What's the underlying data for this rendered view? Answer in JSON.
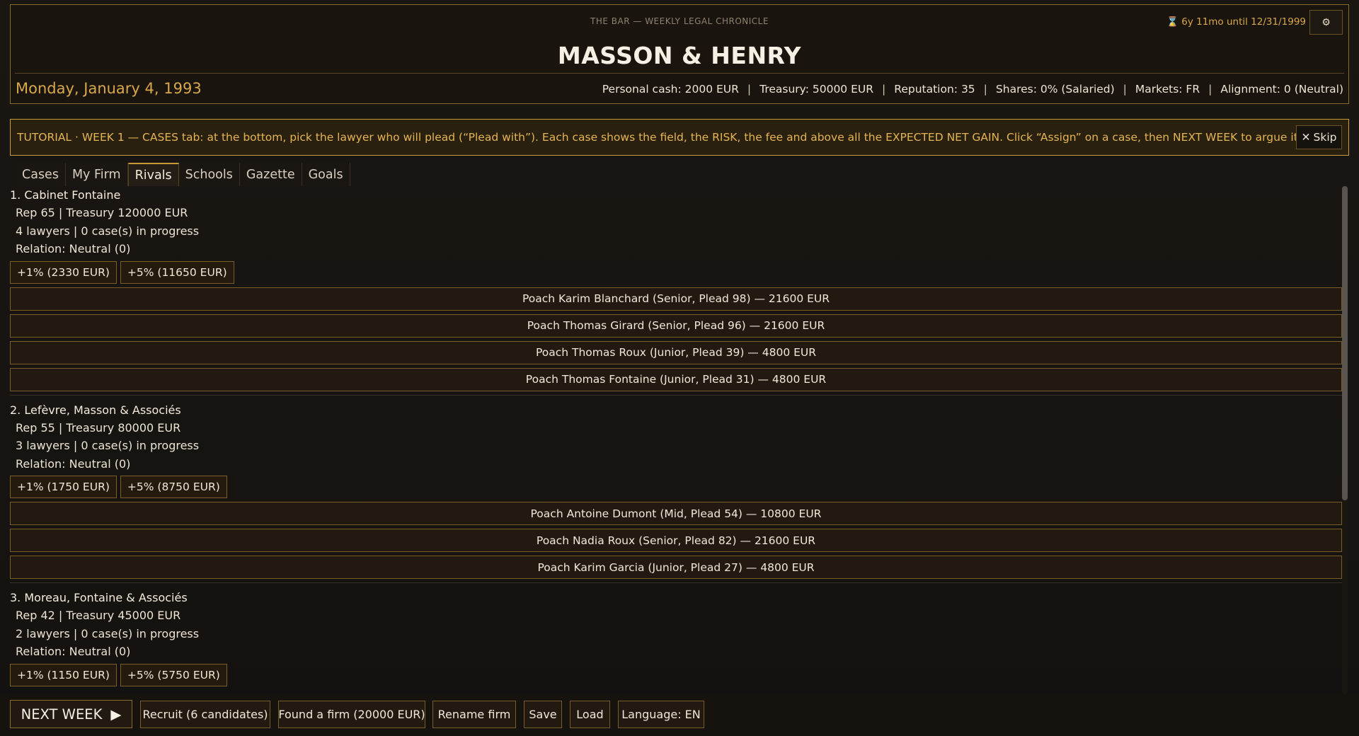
{
  "header": {
    "kicker": "THE BAR  —  WEEKLY LEGAL CHRONICLE",
    "countdown": "6y 11mo until 12/31/1999",
    "countdown_icon": "hourglass-icon",
    "settings_icon": "gear-icon",
    "firm_name": "MASSON & HENRY",
    "date": "Monday, January 4, 1993",
    "stats": [
      "Personal cash: 2000 EUR",
      "Treasury: 50000 EUR",
      "Reputation: 35",
      "Shares: 0% (Salaried)",
      "Markets: FR",
      "Alignment: 0 (Neutral)"
    ],
    "stats_separator": "|"
  },
  "tutorial": {
    "text": "TUTORIAL · WEEK 1 — CASES tab: at the bottom, pick the lawyer who will plead (“Plead with”). Each case shows the field, the RISK, the fee and above all the EXPECTED NET GAIN. Click “Assign” on a case, then NEXT WEEK to argue it.",
    "skip_label": "Skip"
  },
  "tabs": [
    {
      "label": "Cases",
      "active": false
    },
    {
      "label": "My Firm",
      "active": false
    },
    {
      "label": "Rivals",
      "active": true
    },
    {
      "label": "Schools",
      "active": false
    },
    {
      "label": "Gazette",
      "active": false
    },
    {
      "label": "Goals",
      "active": false
    }
  ],
  "rivals": [
    {
      "title": "1. Cabinet Fontaine",
      "line1": "Rep 65 | Treasury 120000 EUR",
      "line2": "4 lawyers | 0 case(s) in progress",
      "line3": "Relation: Neutral (0)",
      "share_1": "+1% (2330 EUR)",
      "share_5": "+5% (11650 EUR)",
      "poach": [
        "Poach Karim Blanchard (Senior, Plead 98) — 21600 EUR",
        "Poach Thomas Girard (Senior, Plead 96) — 21600 EUR",
        "Poach Thomas Roux (Junior, Plead 39) — 4800 EUR",
        "Poach Thomas Fontaine (Junior, Plead 31) — 4800 EUR"
      ]
    },
    {
      "title": "2. Lefèvre, Masson & Associés",
      "line1": "Rep 55 | Treasury 80000 EUR",
      "line2": "3 lawyers | 0 case(s) in progress",
      "line3": "Relation: Neutral (0)",
      "share_1": "+1% (1750 EUR)",
      "share_5": "+5% (8750 EUR)",
      "poach": [
        "Poach Antoine Dumont (Mid, Plead 54) — 10800 EUR",
        "Poach Nadia Roux (Senior, Plead 82) — 21600 EUR",
        "Poach Karim Garcia (Junior, Plead 27) — 4800 EUR"
      ]
    },
    {
      "title": "3. Moreau, Fontaine & Associés",
      "line1": "Rep 42 | Treasury 45000 EUR",
      "line2": "2 lawyers | 0 case(s) in progress",
      "line3": "Relation: Neutral (0)",
      "share_1": "+1% (1150 EUR)",
      "share_5": "+5% (5750 EUR)",
      "poach": []
    }
  ],
  "bottom_bar": {
    "next_week": "NEXT WEEK",
    "recruit": "Recruit (6 candidates)",
    "found_firm": "Found a firm (20000 EUR)",
    "rename": "Rename firm",
    "save": "Save",
    "load": "Load",
    "language": "Language: EN"
  },
  "colors": {
    "accent_gold": "#d8a84a",
    "border_gold": "#8a6a2a",
    "background": "#141210"
  }
}
